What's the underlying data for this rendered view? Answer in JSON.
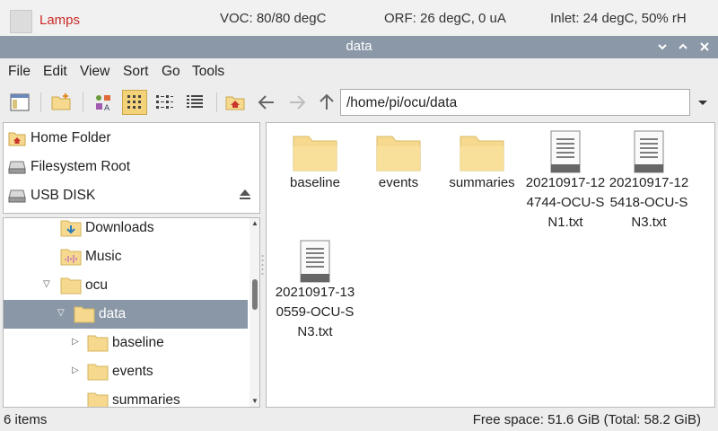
{
  "statusbar": {
    "lamps_label": "Lamps",
    "voc": "VOC: 80/80 degC",
    "orf": "ORF: 26 degC, 0 uA",
    "inlet": "Inlet: 24 degC, 50% rH"
  },
  "window": {
    "title": "data",
    "controls": [
      "minimize-icon",
      "maximize-icon",
      "close-icon"
    ]
  },
  "menu": [
    "File",
    "Edit",
    "View",
    "Sort",
    "Go",
    "Tools"
  ],
  "toolbar": {
    "buttons": [
      "new-window-icon",
      "new-folder-icon",
      "icon-view-icon",
      "thumbnail-view-icon",
      "compact-view-icon",
      "detailed-list-icon",
      "home-icon",
      "back-arrow-icon",
      "forward-arrow-icon",
      "up-arrow-icon"
    ],
    "path": "/home/pi/ocu/data"
  },
  "places": [
    {
      "label": "Home Folder",
      "icon": "home-folder-icon"
    },
    {
      "label": "Filesystem Root",
      "icon": "drive-icon"
    },
    {
      "label": "USB DISK",
      "icon": "usb-drive-icon"
    }
  ],
  "tree": [
    {
      "label": "Downloads",
      "icon": "downloads-folder-icon"
    },
    {
      "label": "Music",
      "icon": "music-folder-icon"
    },
    {
      "label": "ocu",
      "icon": "folder-icon",
      "expanded": true
    },
    {
      "label": "data",
      "icon": "folder-icon",
      "expanded": true,
      "selected": true
    },
    {
      "label": "baseline",
      "icon": "folder-icon",
      "expanded": false
    },
    {
      "label": "events",
      "icon": "folder-icon",
      "expanded": false
    },
    {
      "label": "summaries",
      "icon": "folder-icon"
    }
  ],
  "files": [
    {
      "name": "baseline",
      "type": "folder"
    },
    {
      "name": "events",
      "type": "folder"
    },
    {
      "name": "summaries",
      "type": "folder"
    },
    {
      "name": "20210917-124744-OCU-SN1.txt",
      "type": "text"
    },
    {
      "name": "20210917-125418-OCU-SN3.txt",
      "type": "text"
    },
    {
      "name": "20210917-130559-OCU-SN3.txt",
      "type": "text"
    }
  ],
  "status": {
    "count": "6 items",
    "free": "Free space: 51.6 GiB (Total: 58.2 GiB)"
  },
  "colors": {
    "titlebar": "#8b98a8",
    "selection": "#8a97a7",
    "folder": "#f6d98f",
    "lamps_text": "#cc2b2b"
  }
}
